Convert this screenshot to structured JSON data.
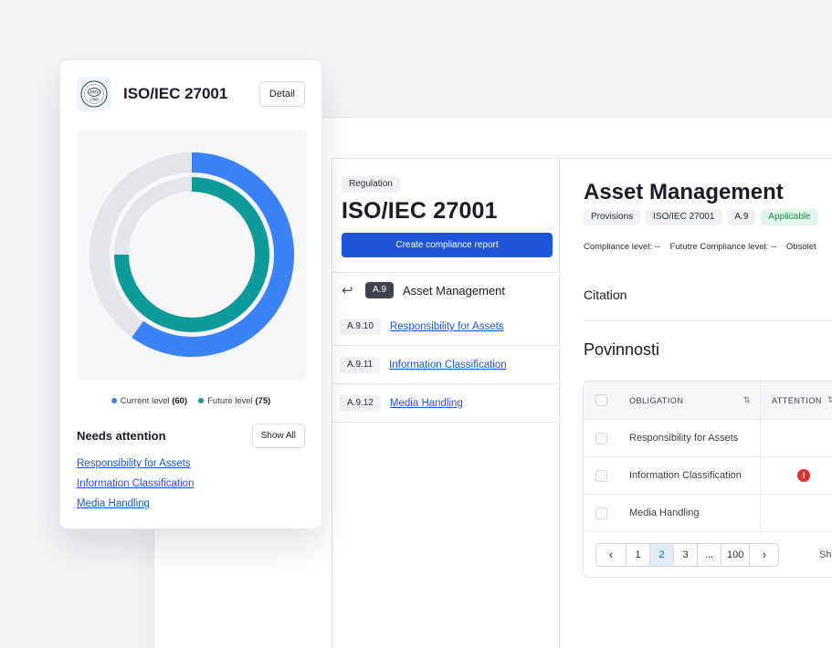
{
  "card": {
    "logo_text": "ISO 27001",
    "title": "ISO/IEC 27001",
    "detail_label": "Detail",
    "legend": [
      {
        "label": "Current level",
        "value": "(60)",
        "color": "#3b82f6"
      },
      {
        "label": "Future level",
        "value": "(75)",
        "color": "#0f9a9a"
      }
    ],
    "needs_attention_title": "Needs attention",
    "show_all_label": "Show All",
    "attention_items": [
      "Responsibility for Assets",
      "Information Classification",
      "Media Handling"
    ]
  },
  "chart_data": {
    "type": "pie",
    "title": "",
    "series": [
      {
        "name": "Current level",
        "value": 60,
        "max": 100,
        "color": "#3b82f6"
      },
      {
        "name": "Future level",
        "value": 75,
        "max": 100,
        "color": "#0f9a9a"
      }
    ],
    "track_color": "#e3e5e9"
  },
  "nav": {
    "regulation_chip": "Regulation",
    "regulation_title": "ISO/IEC 27001",
    "create_report_label": "Create compliance report",
    "section_code": "A.9",
    "section_title": "Asset Management",
    "items": [
      {
        "code": "A.9.10",
        "label": "Responsibility for Assets"
      },
      {
        "code": "A.9.11",
        "label": "Information Classification"
      },
      {
        "code": "A.9.12",
        "label": "Media Handling"
      }
    ]
  },
  "main": {
    "title": "Asset Management",
    "chips": {
      "provisions": "Provisions",
      "regulation": "ISO/IEC 27001",
      "code": "A.9",
      "status": "Applicable"
    },
    "levels": {
      "compliance": "Compliance level:  --",
      "future": "Fututre Compliance level:  --",
      "obsolete": "Obsolet"
    },
    "citation_label": "Citation",
    "obligations_title": "Povinnosti",
    "table": {
      "headers": {
        "obligation": "OBLIGATION",
        "attention": "ATTENTION"
      },
      "rows": [
        {
          "obligation": "Responsibility for Assets",
          "attention": false
        },
        {
          "obligation": "Information Classification",
          "attention": true
        },
        {
          "obligation": "Media Handling",
          "attention": false
        }
      ]
    },
    "pagination": {
      "prev": "‹",
      "pages": [
        "1",
        "2",
        "3",
        "...",
        "100"
      ],
      "active": "2",
      "next": "›",
      "show_label": "Sh"
    }
  }
}
